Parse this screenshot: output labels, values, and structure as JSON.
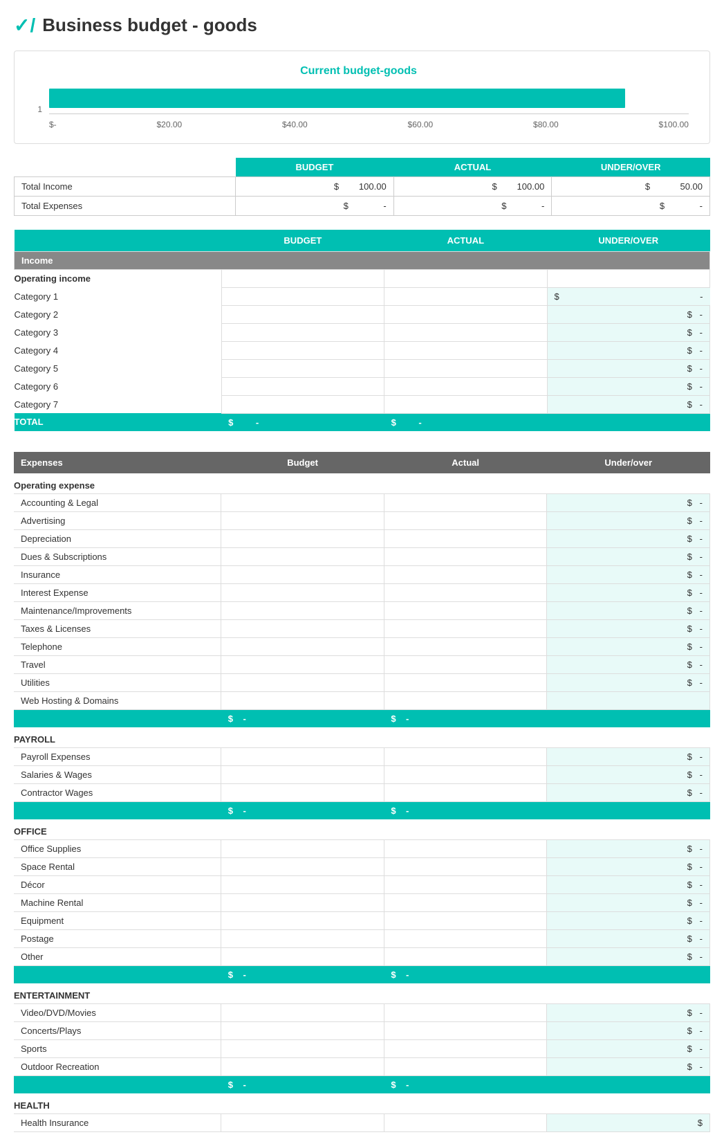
{
  "page": {
    "title": "Business budget - goods",
    "logo": "✓"
  },
  "chart": {
    "title": "Current budget-goods",
    "bar_width_pct": 90,
    "y_label": "1",
    "x_labels": [
      "$-",
      "$20.00",
      "$40.00",
      "$60.00",
      "$80.00",
      "$100.00"
    ]
  },
  "summary": {
    "columns": [
      "BUDGET",
      "ACTUAL",
      "UNDER/OVER"
    ],
    "rows": [
      {
        "label": "Total Income",
        "budget": "$ 100.00",
        "actual": "$ 100.00",
        "under_over": "$ 50.00"
      },
      {
        "label": "Total Expenses",
        "budget": "$   -",
        "actual": "$   -",
        "under_over": "$   -"
      }
    ]
  },
  "income_table": {
    "columns": [
      "BUDGET",
      "ACTUAL",
      "UNDER/OVER"
    ],
    "section_label": "Income",
    "sub_section": "Operating income",
    "categories": [
      "Category 1",
      "Category 2",
      "Category 3",
      "Category 4",
      "Category 5",
      "Category 6",
      "Category 7"
    ],
    "total_label": "TOTAL"
  },
  "expenses_table": {
    "header_cols": [
      "Expenses",
      "Budget",
      "Actual",
      "Under/over"
    ],
    "operating_expense": {
      "label": "Operating expense",
      "items": [
        "Accounting & Legal",
        "Advertising",
        "Depreciation",
        "Dues & Subscriptions",
        "Insurance",
        "Interest Expense",
        "Maintenance/Improvements",
        "Taxes & Licenses",
        "Telephone",
        "Travel",
        "Utilities",
        "Web Hosting & Domains"
      ]
    },
    "payroll": {
      "label": "PAYROLL",
      "items": [
        "Payroll Expenses",
        "Salaries & Wages",
        "Contractor Wages"
      ]
    },
    "office": {
      "label": "OFFICE",
      "items": [
        "Office Supplies",
        "Space Rental",
        "Décor",
        "Machine Rental",
        "Equipment",
        "Postage",
        "Other"
      ]
    },
    "entertainment": {
      "label": "ENTERTAINMENT",
      "items": [
        "Video/DVD/Movies",
        "Concerts/Plays",
        "Sports",
        "Outdoor Recreation"
      ]
    },
    "health": {
      "label": "HEALTH",
      "items": [
        "Health Insurance"
      ]
    }
  },
  "colors": {
    "teal": "#00bfb2",
    "gray_header": "#888888",
    "light_teal_bg": "#e8faf8"
  }
}
